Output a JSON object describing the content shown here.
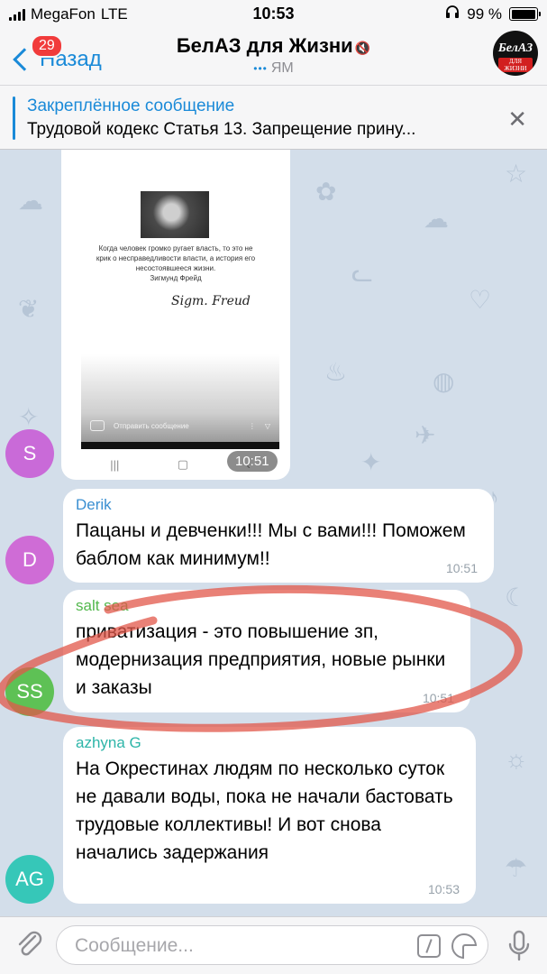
{
  "status_bar": {
    "carrier": "MegaFon",
    "network": "LTE",
    "time": "10:53",
    "battery_percent": "99 %",
    "battery_level": 0.99
  },
  "nav": {
    "back_label": "Назад",
    "unread_count": "29",
    "title": "БелАЗ для Жизни",
    "subtitle": "ЯМ",
    "avatar_line1": "БелАЗ",
    "avatar_line2": "ДЛЯ ЖИЗНИ"
  },
  "pinned": {
    "title": "Закреплённое сообщение",
    "text": "Трудовой кодекс  Статья 13. Запрещение прину..."
  },
  "image_message": {
    "quote": "Когда человек громко ругает власть, то это не крик о несправедливости власти, а история его несостоявшееся жизни.",
    "author": "Зигмунд Фрейд",
    "signature": "Sigm. Freud",
    "story_placeholder": "Отправить сообщение",
    "time": "10:51",
    "avatar_letter": "S",
    "avatar_color": "#c96ad8"
  },
  "messages": [
    {
      "avatar": "D",
      "avatar_color": "#cf6cd6",
      "name": "Derik",
      "name_color": "#3a8fd1",
      "text": "Пацаны и девченки!!!   Мы с вами!!! Поможем баблом как минимум!!",
      "time": "10:51"
    },
    {
      "avatar": "SS",
      "avatar_color": "#5ec155",
      "name": "salt sea",
      "name_color": "#53b84d",
      "text": "приватизация - это повышение зп, модернизация предприятия, новые рынки и заказы",
      "time": "10:51"
    },
    {
      "avatar": "AG",
      "avatar_color": "#36c7b8",
      "name": "azhyna G",
      "name_color": "#2db5a8",
      "text": "На Окрестинах людям по несколько суток не давали воды, пока не начали бастовать трудовые коллективы! И вот снова начались задержания",
      "time": "10:53"
    }
  ],
  "input": {
    "placeholder": "Сообщение..."
  }
}
